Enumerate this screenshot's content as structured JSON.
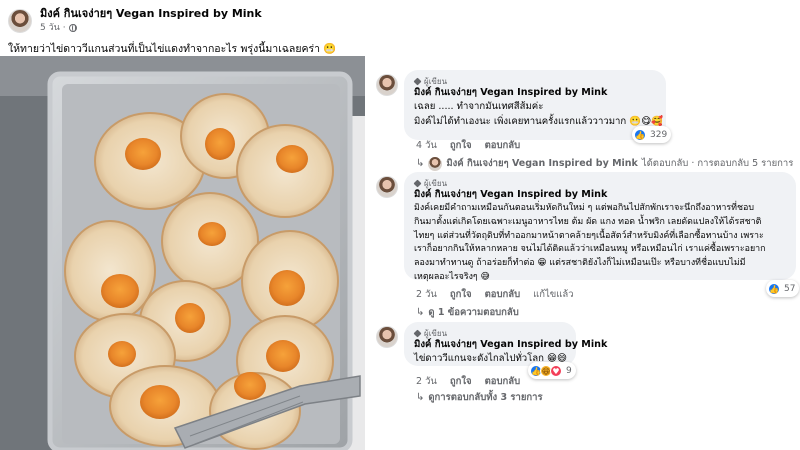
{
  "post": {
    "author": "มิงค์ กินเจง่ายๆ Vegan Inspired by Mink",
    "time": "5 วัน",
    "caption": "ให้ทายว่าไข่ดาววีแกนส่วนที่เป็นไข่แดงทำจากอะไร พรุ่งนี้มาเฉลยคร่า 😬"
  },
  "photo": {
    "description_icon": "tray-of-vegan-fried-eggs"
  },
  "comments": [
    {
      "badge": "ผู้เขียน",
      "author": "มิงค์ กินเจง่ายๆ Vegan Inspired by Mink",
      "lines": [
        "เฉลย ..... ทำจากมันเทศสีส้มค่ะ",
        "มิงค์ไม่ได้ทำเองนะ เพิ่งเคยทานครั้งแรกแล้ววาวมาก 😬😋🥰"
      ],
      "time": "4 วัน",
      "like": "ถูกใจ",
      "reply": "ตอบกลับ",
      "reaction_count": "329",
      "reply_summary_author": "มิงค์ กินเจง่ายๆ Vegan Inspired by Mink",
      "reply_summary_text": "ได้ตอบกลับ · การตอบกลับ 5 รายการ"
    },
    {
      "badge": "ผู้เขียน",
      "author": "มิงค์ กินเจง่ายๆ Vegan Inspired by Mink",
      "lines": [
        "มิงค์เคยมีคำถามเหมือนกันตอนเริ่มหัดกินใหม่ ๆ แต่พอกินไปสักพักเราจะนึกถึงอาหารที่ชอบ",
        "กินมาตั้งแต่เกิดโดยเฉพาะเมนูอาหารไทย ต้ม ผัด แกง ทอด น้ำพริก เลยดัดแปลงให้ได้รสชาติ",
        "ไทยๆ แต่ส่วนที่วัตถุดิบที่ทำออกมาหน้าตาคล้ายๆเนื้อสัตว์สำหรับมิงค์ที่เลือกซื้อทานบ้าง เพราะ",
        "เราก็อยากกินให้หลากหลาย จนไม่ได้ติดแล้วว่าเหมือนหมู หรือเหมือนไก่ เราแค่ซื้อเพราะอยาก",
        "ลองมาทำทานดู ถ้าอร่อยก็ทำต่อ 😁 แต่รสชาติยังไงก็ไม่เหมือนเป๊ะ หรือบางทีชื่อแบบไม่มี",
        "เหตุผลอะไรจริงๆ 😅"
      ],
      "time": "2 วัน",
      "like": "ถูกใจ",
      "reply": "ตอบกลับ",
      "edited": "แก้ไขแล้ว",
      "reaction_count": "57",
      "reply_summary_text": "ดู 1 ข้อความตอบกลับ"
    },
    {
      "badge": "ผู้เขียน",
      "author": "มิงค์ กินเจง่ายๆ Vegan Inspired by Mink",
      "lines": [
        "ไข่ดาววีแกนจะดังไกลไปทั่วโลก 😁😄"
      ],
      "time": "2 วัน",
      "like": "ถูกใจ",
      "reply": "ตอบกลับ",
      "reaction_count": "9",
      "reply_summary_text": "ดูการตอบกลับทั้ง 3 รายการ"
    }
  ],
  "colors": {
    "bubble": "#f0f2f5",
    "meta_text": "#65676b",
    "like_blue": "#1877f2",
    "tray": "#b9bcc0"
  }
}
